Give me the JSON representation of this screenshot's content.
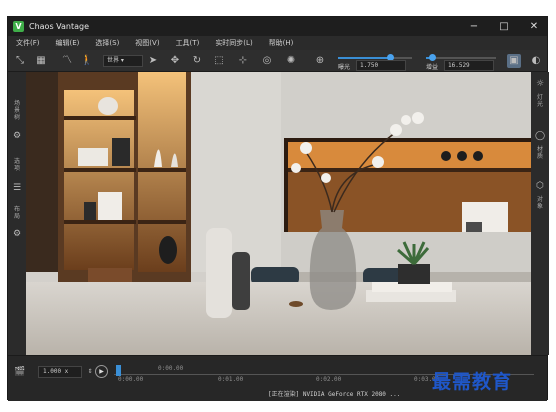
{
  "app": {
    "title": "Chaos Vantage",
    "logo_letter": "V"
  },
  "window_controls": {
    "minimize": "−",
    "maximize": "□",
    "close": "✕"
  },
  "menu": [
    "文件(F)",
    "编辑(E)",
    "选择(S)",
    "视图(V)",
    "工具(T)",
    "实时同步(L)",
    "帮助(H)"
  ],
  "toolbar": {
    "space_select": "世界",
    "exposure": {
      "label": "曝光",
      "value": "1.750",
      "level": 0.7
    },
    "gain": {
      "label": "增益",
      "value": "16.529",
      "level": 0.08
    },
    "icons": [
      "move-axis-icon",
      "render-mode-icon",
      "curve-icon",
      "walk-icon",
      "select-arrow-icon",
      "move-icon",
      "rotate-icon",
      "scale-icon",
      "pick-focus-icon",
      "lens-icon",
      "sun-icon",
      "target-icon",
      "snapshot-icon",
      "help-icon"
    ]
  },
  "left_sidebar": {
    "items": [
      {
        "label": "场景树",
        "icon": "scene-tree-icon"
      },
      {
        "label": "选项",
        "icon": "options-icon"
      },
      {
        "label": "布局",
        "icon": "layout-icon"
      },
      {
        "label": "设置",
        "icon": "settings-icon"
      }
    ]
  },
  "right_sidebar": {
    "items": [
      {
        "label": "灯光",
        "icon": "light-icon"
      },
      {
        "label": "材质",
        "icon": "material-icon"
      },
      {
        "label": "对象",
        "icon": "object-icon"
      }
    ]
  },
  "timeline": {
    "speed": "1.000 x",
    "top_time": "0:00.00",
    "marks": [
      "0:00.00",
      "0:01.00",
      "0:02.00",
      "0:03.00"
    ]
  },
  "status": {
    "text": "[正在渲染] NVIDIA GeForce RTX 2080 ...",
    "fps": ""
  },
  "watermark": "最需教育",
  "colors": {
    "accent": "#3a8fd6",
    "logo": "#3fae49",
    "watermark": "#1f57c9"
  }
}
